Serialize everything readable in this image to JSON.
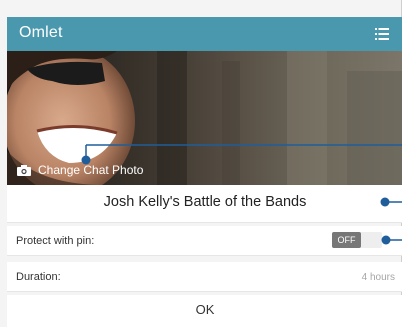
{
  "header": {
    "app_title": "Omlet"
  },
  "photo": {
    "change_label": "Change Chat Photo"
  },
  "chat": {
    "title": "Josh Kelly's Battle of the Bands"
  },
  "settings": {
    "pin_label": "Protect with pin:",
    "pin_toggle_state": "OFF",
    "duration_label": "Duration:",
    "duration_value": "4 hours"
  },
  "actions": {
    "ok_label": "OK"
  },
  "colors": {
    "header": "#4a98ae",
    "callout": "#1f5e9a"
  },
  "icons": {
    "menu": "list-menu-icon",
    "camera": "camera-icon"
  }
}
